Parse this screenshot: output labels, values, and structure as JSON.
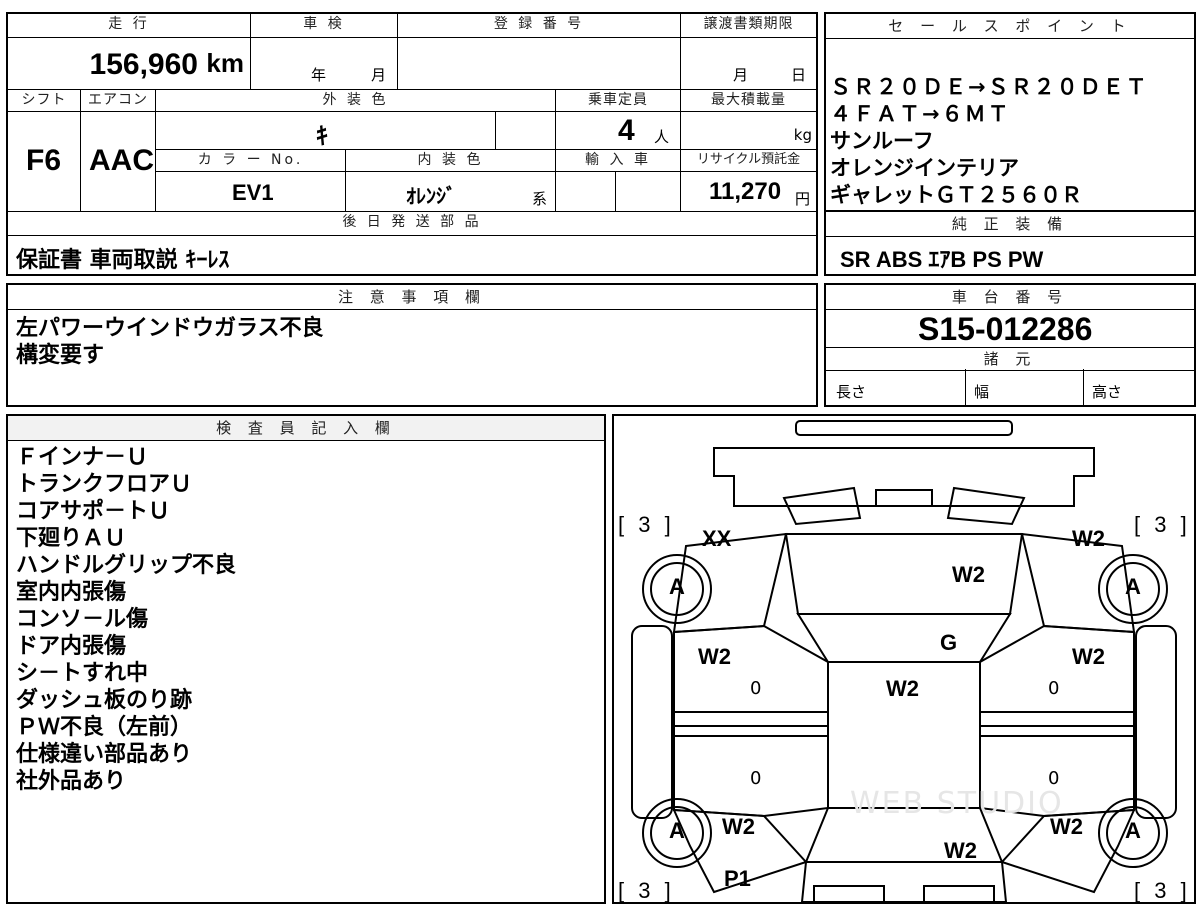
{
  "vehicle": {
    "mileage_label": "走 行",
    "mileage_value": "156,960",
    "mileage_unit": "km",
    "shaken_label": "車 検",
    "shaken_year": "年",
    "shaken_month": "月",
    "registration_label": "登 録 番 号",
    "transfer_label": "譲渡書類期限",
    "transfer_month": "月",
    "transfer_day": "日",
    "shift_label": "シフト",
    "shift_value": "F6",
    "aircon_label": "エアコン",
    "aircon_value": "AAC",
    "exterior_label": "外 装 色",
    "exterior_value": "ｷ",
    "capacity_label": "乗車定員",
    "capacity_value": "4",
    "capacity_unit": "人",
    "load_label": "最大積載量",
    "load_unit": "kg",
    "color_no_label": "カ ラ ー No.",
    "color_no_value": "EV1",
    "interior_label": "内 装 色",
    "interior_value": "ｵﾚﾝｼﾞ",
    "interior_suffix": "系",
    "import_label": "輸 入 車",
    "recycle_label": "リサイクル預託金",
    "recycle_value": "11,270",
    "recycle_unit": "円",
    "later_parts_label": "後 日 発 送 部 品",
    "later_parts_value": "保証書 車両取説 ｷｰﾚｽ"
  },
  "sales_points": {
    "label": "セ ー ル ス ポ イ ン ト",
    "lines": [
      "ＳＲ２０ＤＥ→ＳＲ２０ＤＥＴ",
      "４ＦＡＴ→６ＭＴ",
      "サンルーフ",
      "オレンジインテリア",
      "ギャレットＧＴ２５６０Ｒ"
    ]
  },
  "equipment": {
    "label": "純 正 装 備",
    "value": "SR ABS ｴｱB PS PW"
  },
  "notes": {
    "label": "注 意 事 項 欄",
    "lines": [
      "左パワーウインドウガラス不良",
      "構変要す"
    ]
  },
  "chassis": {
    "label": "車 台 番 号",
    "value": "S15-012286",
    "specs_label": "諸 元",
    "length_label": "長さ",
    "width_label": "幅",
    "height_label": "高さ"
  },
  "inspector": {
    "label": "検 査 員 記 入 欄",
    "lines": [
      "Ｆインナ－Ｕ",
      "トランクフロアＵ",
      "コアサポ－トＵ",
      "下廻りＡＵ",
      "ハンドルグリップ不良",
      "室内内張傷",
      "コンソ－ル傷",
      "ドア内張傷",
      "シ－トすれ中",
      "ダッシュ板のり跡",
      "ＰＷ不良（左前）",
      "仕様違い部品あり",
      "社外品あり"
    ]
  },
  "diagram": {
    "bracket_label": "[ 3 ]",
    "tire_label": "A",
    "marks": {
      "front_left": "XX",
      "hood": "W2",
      "front_right_fender": "W2",
      "windshield": "G",
      "left_front_door": "W2",
      "right_front_door": "W2",
      "roof": "W2",
      "left_rear": "W2",
      "right_rear": "W2",
      "trunk": "W2",
      "rear_left_bumper": "P1",
      "door_mark_a": "0",
      "door_mark_b": "0",
      "door_mark_c": "0",
      "door_mark_d": "0"
    },
    "watermark": "WEB STUDIO"
  }
}
